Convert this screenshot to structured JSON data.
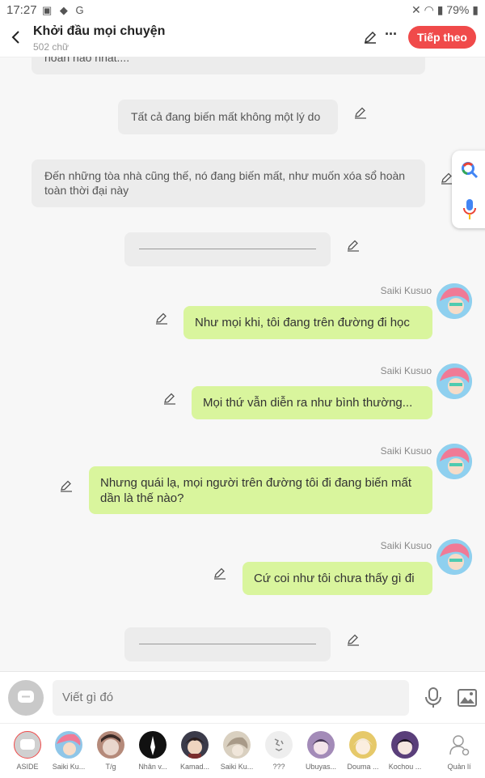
{
  "status_bar": {
    "time": "17:27",
    "battery": "79%",
    "accent": "#f04a4a"
  },
  "header": {
    "title": "Khởi đầu mọi chuyện",
    "subtitle": "502 chữ",
    "next_label": "Tiếp theo"
  },
  "messages": [
    {
      "type": "narration",
      "text": "hoàn hảo nhất...."
    },
    {
      "type": "narration",
      "text": "Tất cả đang biến mất không một lý do"
    },
    {
      "type": "narration",
      "text": "Đến những tòa nhà cũng thế, nó đang biến mất, như muốn xóa sổ hoàn toàn thời đại này"
    },
    {
      "type": "divider",
      "text": ""
    },
    {
      "type": "dialogue",
      "speaker": "Saiki Kusuo",
      "text": "Như mọi khi, tôi đang trên đường đi học"
    },
    {
      "type": "dialogue",
      "speaker": "Saiki Kusuo",
      "text": "Mọi thứ vẫn diễn ra như bình thường..."
    },
    {
      "type": "dialogue",
      "speaker": "Saiki Kusuo",
      "text": "Nhưng quái lạ, mọi người trên đường tôi đi đang biến mất dần là thế nào?"
    },
    {
      "type": "dialogue",
      "speaker": "Saiki Kusuo",
      "text": "Cứ coi như tôi chưa thấy gì đi"
    },
    {
      "type": "divider",
      "text": ""
    }
  ],
  "composer": {
    "placeholder": "Viết gì đó"
  },
  "characters": [
    {
      "label": "ASIDE",
      "color": "#d0d0d0"
    },
    {
      "label": "Saiki Ku...",
      "color": "#8fc6e8"
    },
    {
      "label": "T/g",
      "color": "#b58a7a"
    },
    {
      "label": "Nhân v...",
      "color": "#111111"
    },
    {
      "label": "Kamad...",
      "color": "#3b3b4a"
    },
    {
      "label": "Saiki Ku...",
      "color": "#d9d0c0"
    },
    {
      "label": "???",
      "color": "#eeeeee"
    },
    {
      "label": "Ubuyas...",
      "color": "#a38bb8"
    },
    {
      "label": "Douma ...",
      "color": "#e6c96a"
    },
    {
      "label": "Kochou ...",
      "color": "#5a3f7a"
    },
    {
      "label": "Quản lí",
      "color": "#ffffff"
    }
  ]
}
